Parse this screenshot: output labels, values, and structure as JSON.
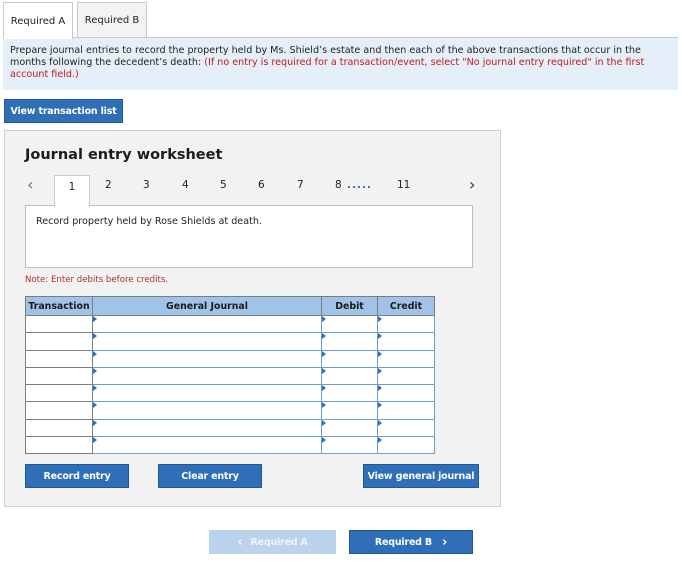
{
  "tabs": [
    {
      "label": "Required A",
      "active": true
    },
    {
      "label": "Required B",
      "active": false
    }
  ],
  "instructions": {
    "main": "Prepare journal entries to record the property held by Ms. Shield’s estate and then each of the above transactions that occur in the months following the decedent’s death: ",
    "hint": "(If no entry is required for a transaction/event, select \"No journal entry required\" in the first account field.)"
  },
  "view_transaction_list": "View transaction list",
  "worksheet": {
    "title": "Journal entry worksheet",
    "pages": [
      "1",
      "2",
      "3",
      "4",
      "5",
      "6",
      "7",
      "8",
      "11"
    ],
    "ellipsis": ".....",
    "active_page": "1",
    "prev_icon": "chevron-left-icon",
    "next_icon": "chevron-right-icon",
    "description": "Record property held by Rose Shields at death.",
    "note": "Note: Enter debits before credits.",
    "columns": [
      "Transaction",
      "General Journal",
      "Debit",
      "Credit"
    ],
    "rows": [
      {
        "transaction": "",
        "account": "",
        "debit": "",
        "credit": ""
      },
      {
        "transaction": "",
        "account": "",
        "debit": "",
        "credit": ""
      },
      {
        "transaction": "",
        "account": "",
        "debit": "",
        "credit": ""
      },
      {
        "transaction": "",
        "account": "",
        "debit": "",
        "credit": ""
      },
      {
        "transaction": "",
        "account": "",
        "debit": "",
        "credit": ""
      },
      {
        "transaction": "",
        "account": "",
        "debit": "",
        "credit": ""
      },
      {
        "transaction": "",
        "account": "",
        "debit": "",
        "credit": ""
      },
      {
        "transaction": "",
        "account": "",
        "debit": "",
        "credit": ""
      }
    ],
    "record_entry": "Record entry",
    "clear_entry": "Clear entry",
    "view_general_journal": "View general journal"
  },
  "nav": {
    "prev_label": "Required A",
    "next_label": "Required B",
    "prev_glyph": "‹",
    "next_glyph": "›"
  },
  "colors": {
    "accent": "#2e6fb7",
    "header_bg": "#9fc4e8",
    "instructions_bg": "#e4eff9",
    "note_red": "#b3302a"
  }
}
